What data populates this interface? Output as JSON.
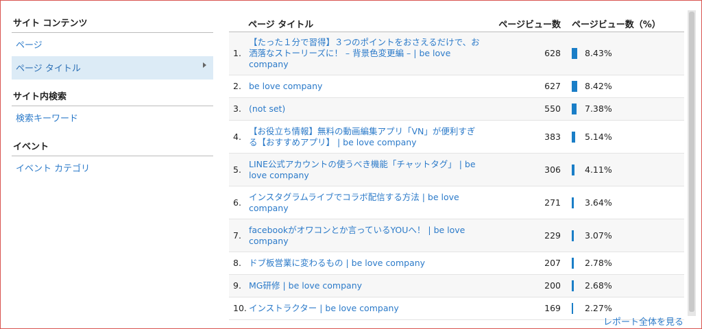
{
  "sidebar": {
    "sections": [
      {
        "heading": "サイト コンテンツ",
        "items": [
          {
            "label": "ページ",
            "active": false
          },
          {
            "label": "ページ タイトル",
            "active": true
          }
        ]
      },
      {
        "heading": "サイト内検索",
        "items": [
          {
            "label": "検索キーワード",
            "active": false
          }
        ]
      },
      {
        "heading": "イベント",
        "items": [
          {
            "label": "イベント カテゴリ",
            "active": false
          }
        ]
      }
    ]
  },
  "table": {
    "headers": {
      "title": "ページ タイトル",
      "views": "ページビュー数",
      "pct": "ページビュー数（%）"
    },
    "rows": [
      {
        "num": "1.",
        "title": "【たった１分で習得】３つのポイントをおさえるだけで、お洒落なストーリーズに！ – 背景色変更編 – | be love company",
        "views": "628",
        "pct": "8.43%",
        "share": 8.43
      },
      {
        "num": "2.",
        "title": "be love company",
        "views": "627",
        "pct": "8.42%",
        "share": 8.42
      },
      {
        "num": "3.",
        "title": "(not set)",
        "views": "550",
        "pct": "7.38%",
        "share": 7.38
      },
      {
        "num": "4.",
        "title": "【お役立ち情報】無料の動画編集アプリ「VN」が便利すぎる【おすすめアプリ】 | be love company",
        "views": "383",
        "pct": "5.14%",
        "share": 5.14
      },
      {
        "num": "5.",
        "title": "LINE公式アカウントの使うべき機能「チャットタグ」 | be love company",
        "views": "306",
        "pct": "4.11%",
        "share": 4.11
      },
      {
        "num": "6.",
        "title": "インスタグラムライブでコラボ配信する方法 | be love company",
        "views": "271",
        "pct": "3.64%",
        "share": 3.64
      },
      {
        "num": "7.",
        "title": "facebookがオワコンとか言っているYOUへ！ | be love company",
        "views": "229",
        "pct": "3.07%",
        "share": 3.07
      },
      {
        "num": "8.",
        "title": "ドブ板営業に変わるもの | be love company",
        "views": "207",
        "pct": "2.78%",
        "share": 2.78
      },
      {
        "num": "9.",
        "title": "MG研修 | be love company",
        "views": "200",
        "pct": "2.68%",
        "share": 2.68
      },
      {
        "num": "10.",
        "title": "インストラクター | be love company",
        "views": "169",
        "pct": "2.27%",
        "share": 2.27
      }
    ]
  },
  "footer": {
    "full_report_label": "レポート全体を見る"
  },
  "colors": {
    "link": "#2b7ac9",
    "bar": "#1a7ec7",
    "active_bg": "#dcebf6"
  }
}
